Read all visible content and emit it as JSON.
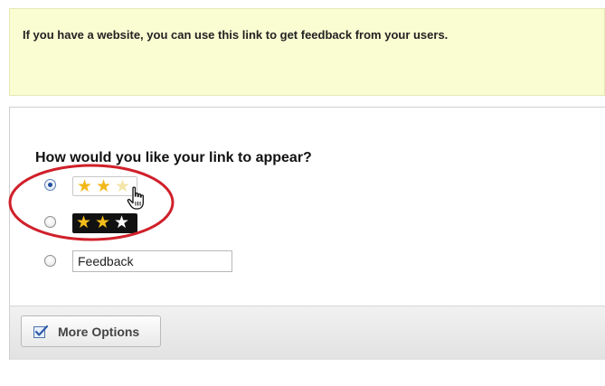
{
  "notice": {
    "text": "If you have a website, you can use this link to get feedback from your users."
  },
  "appearance": {
    "question": "How would you like your link to appear?",
    "selected_option": "light-stars",
    "options": [
      {
        "id": "light-stars",
        "type": "star-rating",
        "theme": "light",
        "filled_stars": 2,
        "total_stars": 3,
        "checked": true
      },
      {
        "id": "dark-stars",
        "type": "star-rating",
        "theme": "dark",
        "filled_stars": 3,
        "total_stars": 3,
        "checked": false
      },
      {
        "id": "text-link",
        "type": "text",
        "value": "Feedback",
        "checked": false
      }
    ]
  },
  "footer": {
    "more_options_label": "More Options"
  },
  "colors": {
    "notice_background": "#fafcd2",
    "star_gold": "#f2b81a",
    "highlight_ring": "#d0202a",
    "radio_selected": "#1f4f9c"
  },
  "icons": {
    "more_options": "checkbox-check-icon",
    "pointer": "hand-pointer-icon"
  }
}
